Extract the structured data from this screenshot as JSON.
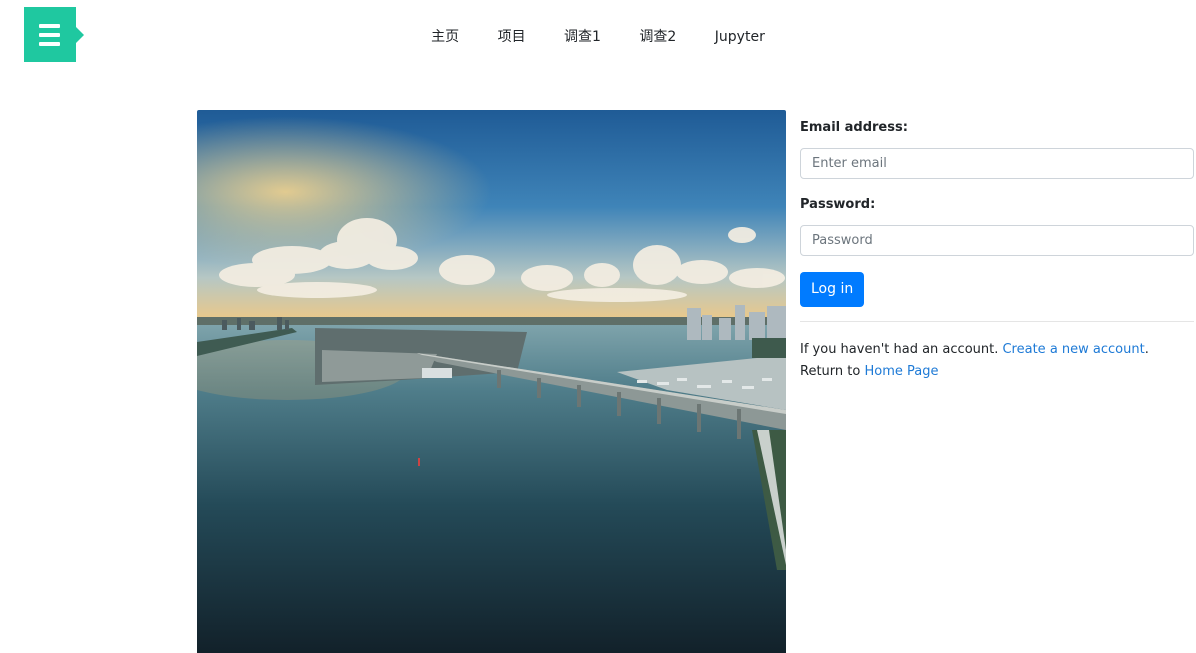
{
  "nav": {
    "items": [
      "主页",
      "项目",
      "调查1",
      "调查2",
      "Jupyter"
    ]
  },
  "form": {
    "email_label": "Email address:",
    "email_placeholder": "Enter email",
    "password_label": "Password:",
    "password_placeholder": "Password",
    "login_button": "Log in"
  },
  "footer": {
    "account_prefix": "If you haven't had an account. ",
    "create_link": "Create a new account",
    "account_suffix": ".",
    "return_prefix": "Return to ",
    "home_link": "Home Page"
  },
  "colors": {
    "brand": "#1fc8a0",
    "primary": "#007bff",
    "link": "#1e7ad6"
  },
  "icons": {
    "logo": "menu-icon"
  }
}
